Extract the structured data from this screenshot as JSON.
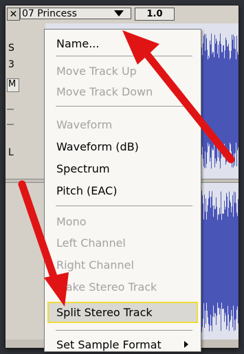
{
  "track": {
    "close_label": "✕",
    "name": "07 Princess",
    "gain": "1.0",
    "left_strip_lines": [
      "S",
      "3",
      "M",
      "L"
    ]
  },
  "menu": {
    "items": [
      {
        "label": "Name...",
        "state": "enabled"
      },
      {
        "label": "Move Track Up",
        "state": "disabled"
      },
      {
        "label": "Move Track Down",
        "state": "disabled"
      },
      {
        "label": "Waveform",
        "state": "disabled"
      },
      {
        "label": "Waveform (dB)",
        "state": "enabled"
      },
      {
        "label": "Spectrum",
        "state": "enabled"
      },
      {
        "label": "Pitch (EAC)",
        "state": "enabled"
      },
      {
        "label": "Mono",
        "state": "disabled"
      },
      {
        "label": "Left Channel",
        "state": "disabled"
      },
      {
        "label": "Right Channel",
        "state": "disabled"
      },
      {
        "label": "Make Stereo Track",
        "state": "disabled"
      },
      {
        "label": "Split Stereo Track",
        "state": "selected"
      },
      {
        "label": "Set Sample Format",
        "state": "enabled",
        "submenu": true
      }
    ]
  },
  "colors": {
    "waveform": "#4a55b8",
    "highlight_border": "#f0dc3c",
    "annotation_arrow": "#e01414"
  },
  "icons": {
    "close": "close-icon",
    "dropdown": "triangle-down-icon",
    "submenu": "chevron-right-icon",
    "annotation": "red-arrow-icon"
  }
}
